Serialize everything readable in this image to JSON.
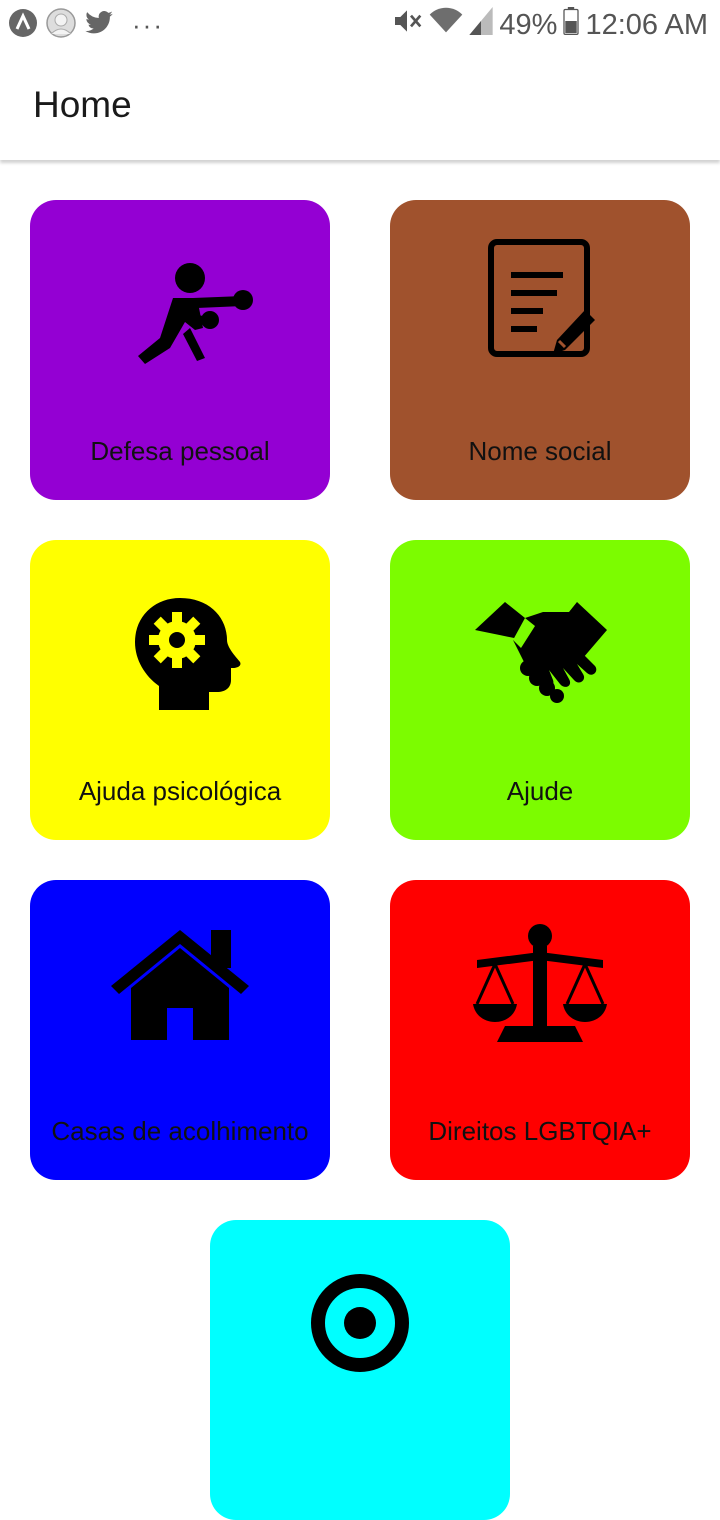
{
  "status_bar": {
    "battery_percent": "49%",
    "time": "12:06 AM",
    "overflow": "···",
    "icons": [
      "app-a-icon",
      "avatar-icon",
      "twitter-icon",
      "mute-icon",
      "wifi-icon",
      "signal-icon",
      "battery-icon"
    ]
  },
  "appbar": {
    "title": "Home"
  },
  "tiles": [
    {
      "label": "Defesa pessoal",
      "color": "#9400D3",
      "icon": "boxer-icon"
    },
    {
      "label": "Nome social",
      "color": "#A0522D",
      "icon": "document-edit-icon"
    },
    {
      "label": "Ajuda psicológica",
      "color": "#FFFF00",
      "icon": "head-gear-icon"
    },
    {
      "label": "Ajude",
      "color": "#7CFC00",
      "icon": "handshake-icon"
    },
    {
      "label": "Casas de acolhimento",
      "color": "#0000FF",
      "icon": "house-icon"
    },
    {
      "label": "Direitos LGBTQIA+",
      "color": "#FF0000",
      "icon": "scales-icon"
    },
    {
      "label": "",
      "color": "#00FFFF",
      "icon": "partial-icon"
    }
  ]
}
